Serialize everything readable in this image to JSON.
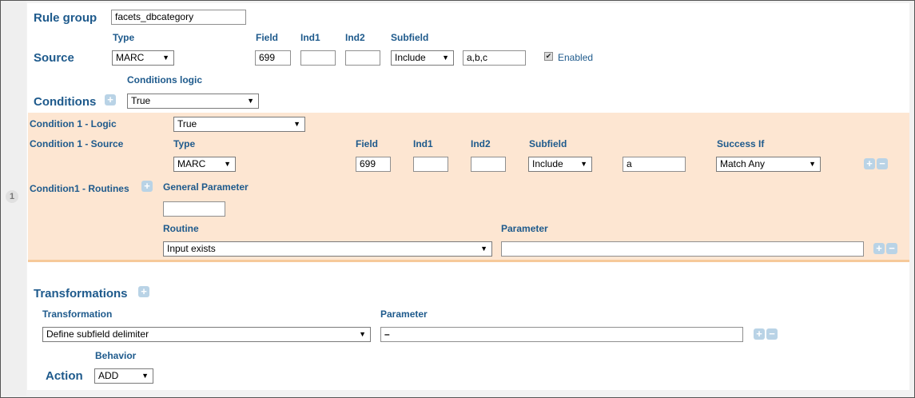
{
  "row_number": "1",
  "rule_group": {
    "label": "Rule group",
    "value": "facets_dbcategory"
  },
  "source": {
    "label": "Source",
    "type_header": "Type",
    "type_value": "MARC",
    "field_header": "Field",
    "field_value": "699",
    "ind1_header": "Ind1",
    "ind1_value": "",
    "ind2_header": "Ind2",
    "ind2_value": "",
    "subfield_header": "Subfield",
    "subfield_mode": "Include",
    "subfield_value": "a,b,c",
    "enabled_label": "Enabled",
    "enabled_checked": true
  },
  "conditions": {
    "label": "Conditions",
    "logic_header": "Conditions logic",
    "logic_value": "True"
  },
  "condition1": {
    "logic_label": "Condition 1 - Logic",
    "logic_value": "True",
    "source_label": "Condition 1 - Source",
    "type_header": "Type",
    "type_value": "MARC",
    "field_header": "Field",
    "field_value": "699",
    "ind1_header": "Ind1",
    "ind1_value": "",
    "ind2_header": "Ind2",
    "ind2_value": "",
    "subfield_header": "Subfield",
    "subfield_mode": "Include",
    "subfield_value": "a",
    "success_header": "Success If",
    "success_value": "Match Any",
    "routines_label": "Condition1 - Routines",
    "general_param_header": "General Parameter",
    "general_param_value": "",
    "routine_header": "Routine",
    "routine_value": "Input exists",
    "parameter_header": "Parameter",
    "parameter_value": ""
  },
  "transformations": {
    "label": "Transformations",
    "transformation_header": "Transformation",
    "transformation_value": "Define subfield delimiter",
    "parameter_header": "Parameter",
    "parameter_value": "–"
  },
  "action": {
    "label": "Action",
    "behavior_header": "Behavior",
    "behavior_value": "ADD"
  },
  "icons": {
    "add": "plus-icon",
    "remove": "minus-icon",
    "dropdown": "chevron-down-icon",
    "check": "checkmark-icon"
  },
  "colors": {
    "heading": "#1e5a8c",
    "condition_band": "#fde6d2",
    "band_border": "#f6c99a",
    "button": "#b9d3e6"
  }
}
